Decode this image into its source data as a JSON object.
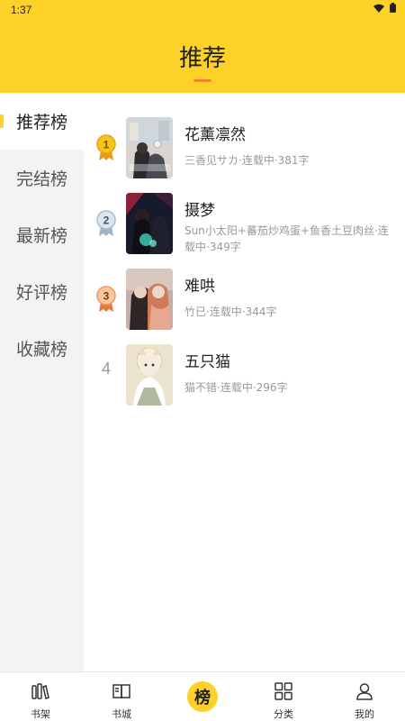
{
  "status": {
    "time": "1:37"
  },
  "header": {
    "title": "推荐"
  },
  "sidebar": {
    "items": [
      {
        "label": "推荐榜",
        "active": true
      },
      {
        "label": "完结榜",
        "active": false
      },
      {
        "label": "最新榜",
        "active": false
      },
      {
        "label": "好评榜",
        "active": false
      },
      {
        "label": "收藏榜",
        "active": false
      }
    ]
  },
  "books": [
    {
      "rank": "1",
      "title": "花薰凛然",
      "meta": "三香见サカ·连载中·381字",
      "badge_color": "#F5C518"
    },
    {
      "rank": "2",
      "title": "摄梦",
      "meta": "Sun小太阳+蕃茄炒鸡蛋+鱼香土豆肉丝·连载中·349字",
      "badge_color": "#C9D6E3"
    },
    {
      "rank": "3",
      "title": "难哄",
      "meta": "竹已·连载中·344字",
      "badge_color": "#F4B183"
    },
    {
      "rank": "4",
      "title": "五只猫",
      "meta": "猫不错·连载中·296字",
      "badge_color": ""
    }
  ],
  "bottom_nav": {
    "items": [
      {
        "label": "书架",
        "icon": "bookshelf-icon"
      },
      {
        "label": "书城",
        "icon": "book-open-icon"
      },
      {
        "label": "",
        "center_glyph": "榜",
        "icon": "ranking-icon"
      },
      {
        "label": "分类",
        "icon": "grid-icon"
      },
      {
        "label": "我的",
        "icon": "user-icon"
      }
    ]
  }
}
